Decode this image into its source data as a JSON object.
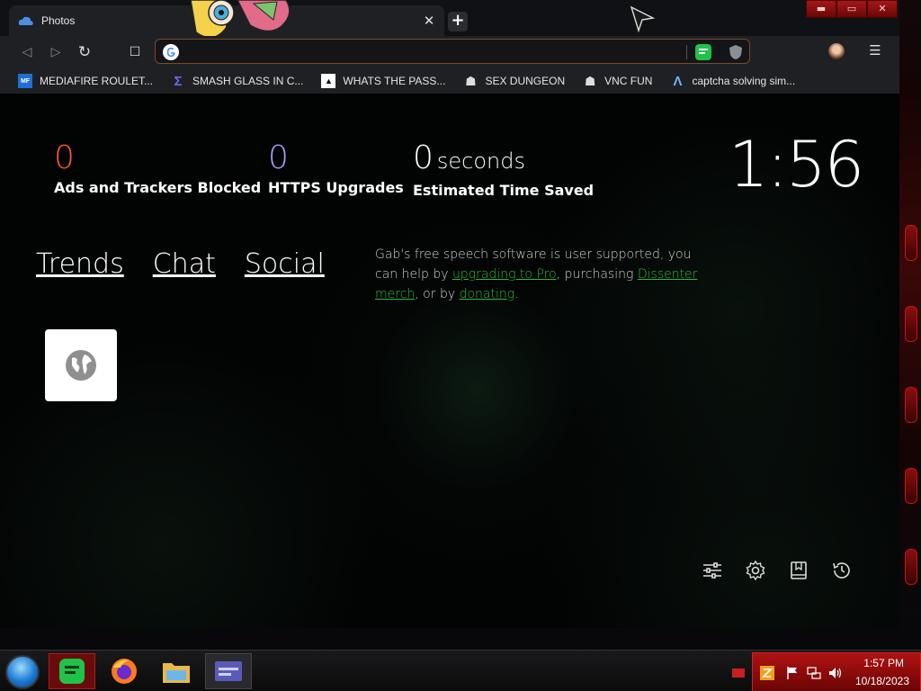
{
  "browser": {
    "tab": {
      "title": "Photos",
      "close_glyph": "✕"
    },
    "new_tab_glyph": "+",
    "window_controls": {
      "minimize": "▬",
      "maximize": "▭",
      "close": "✕"
    },
    "toolbar": {
      "back": "◁",
      "forward": "▷",
      "reload": "↻",
      "bookmark": "☐",
      "menu": "☰"
    },
    "omnibox": {
      "value": "",
      "placeholder": ""
    }
  },
  "bookmarks": [
    {
      "label": "MEDIAFIRE ROULET...",
      "icon": "mediafire-icon"
    },
    {
      "label": "SMASH GLASS IN C...",
      "icon": "sigma-icon"
    },
    {
      "label": "WHATS THE PASS...",
      "icon": "terminal-icon"
    },
    {
      "label": "SEX DUNGEON",
      "icon": "ghost-icon"
    },
    {
      "label": "VNC FUN",
      "icon": "ghost-icon"
    },
    {
      "label": "captcha solving sim...",
      "icon": "lambda-icon"
    }
  ],
  "stats": {
    "ads": {
      "value": "0",
      "label": "Ads and Trackers Blocked",
      "color": "#ff5533"
    },
    "https": {
      "value": "0",
      "label": "HTTPS Upgrades",
      "color": "#a89cf5"
    },
    "time": {
      "value": "0",
      "unit": "seconds",
      "label": "Estimated Time Saved",
      "color": "#ffffff"
    }
  },
  "clock": "1:56",
  "nav_links": {
    "trends": "Trends",
    "chat": "Chat",
    "social": "Social"
  },
  "gab_message": {
    "part1": "Gab's free speech software is user supported, you can help by ",
    "link1": "upgrading to Pro",
    "part2": ", purchasing ",
    "link2": "Dissenter merch",
    "part3": ", or by ",
    "link3": "donating",
    "part4": "."
  },
  "taskbar": {
    "time": "1:57 PM",
    "date": "10/18/2023",
    "accent": "#b01212"
  }
}
